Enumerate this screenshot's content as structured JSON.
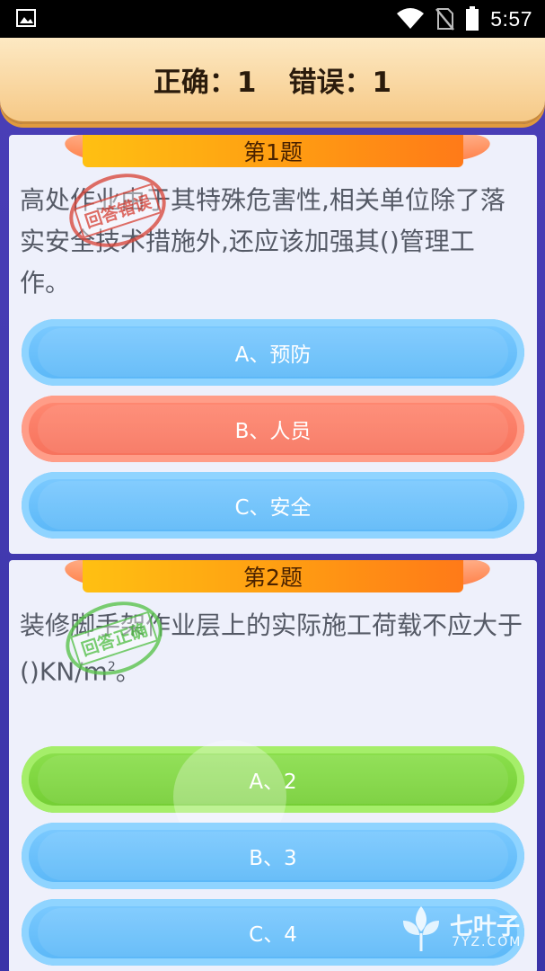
{
  "status_bar": {
    "time": "5:57",
    "icons": [
      "image-icon",
      "wifi-icon",
      "no-sim-icon",
      "battery-icon"
    ]
  },
  "score": {
    "correct_label": "正确：1",
    "wrong_label": "错误：1"
  },
  "questions": [
    {
      "title": "第1题",
      "text": "高处作业由于其特殊危害性,相关单位除了落实安全技术措施外,还应该加强其()管理工作。",
      "stamp": "回答错误",
      "options": [
        {
          "label": "A、预防",
          "state": "default"
        },
        {
          "label": "B、人员",
          "state": "wrong"
        },
        {
          "label": "C、安全",
          "state": "default"
        }
      ]
    },
    {
      "title": "第2题",
      "text_before_sup": "装修脚手架作业层上的实际施工荷载不应大于()KN/m",
      "sup": "2",
      "text_after_sup": "。",
      "stamp": "回答正确",
      "options": [
        {
          "label": "A、2",
          "state": "correct"
        },
        {
          "label": "B、3",
          "state": "default"
        },
        {
          "label": "C、4",
          "state": "default"
        }
      ]
    }
  ],
  "colors": {
    "option_default": "#5fb9f8",
    "option_wrong": "#f6705a",
    "option_correct": "#7ad33a",
    "ribbon": "#ff9c12"
  },
  "watermark": {
    "name": "七叶子",
    "domain": "7YZ.COM"
  }
}
